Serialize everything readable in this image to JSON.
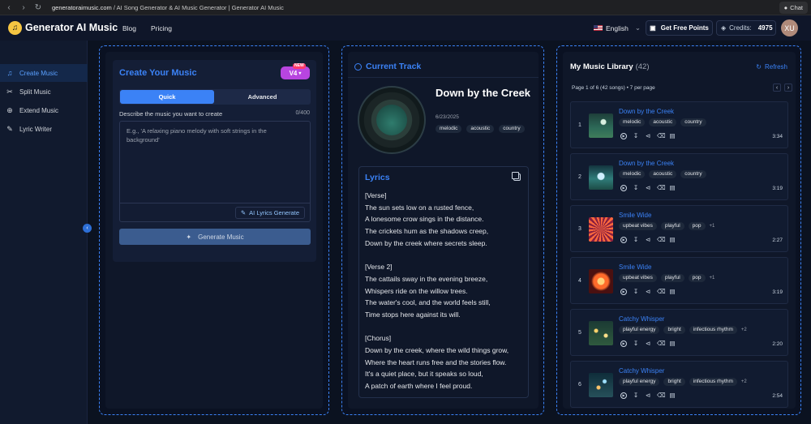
{
  "browser": {
    "url_host": "generatoraimusic.com",
    "url_rest": " / AI Song Generator & AI Music Generator | Generator AI Music",
    "chat_label": "Chat"
  },
  "header": {
    "logo_text": "Generator AI Music",
    "nav": [
      "Blog",
      "Pricing"
    ],
    "language": "English",
    "free_points_label": "Get Free Points",
    "credits_label": "Credits:",
    "credits_value": "4975",
    "avatar_initials": "XU"
  },
  "sidebar": {
    "items": [
      {
        "label": "Create Music",
        "icon": "music-note-icon",
        "active": true
      },
      {
        "label": "Split Music",
        "icon": "scissors-icon",
        "active": false
      },
      {
        "label": "Extend Music",
        "icon": "plus-circle-icon",
        "active": false
      },
      {
        "label": "Lyric Writer",
        "icon": "pencil-icon",
        "active": false
      }
    ]
  },
  "create": {
    "title": "Create Your Music",
    "version": "V4",
    "new_badge": "NEW",
    "tabs": {
      "quick": "Quick",
      "advanced": "Advanced"
    },
    "desc_label": "Describe the music you want to create",
    "char_count": "0/400",
    "placeholder": "E.g., 'A relaxing piano melody with soft strings in the background'",
    "ai_lyrics_label": "AI Lyrics Generate",
    "generate_label": "Generate Music"
  },
  "current": {
    "title": "Current Track",
    "song_title": "Down by the Creek",
    "date": "6/23/2025",
    "tags": [
      "melodic",
      "acoustic",
      "country"
    ],
    "lyrics_title": "Lyrics",
    "lyrics": [
      "[Verse]",
      "The sun sets low on a rusted fence,",
      "A lonesome crow sings in the distance.",
      "The crickets hum as the shadows creep,",
      "Down by the creek where secrets sleep.",
      "",
      "[Verse 2]",
      "The cattails sway in the evening breeze,",
      "Whispers ride on the willow trees.",
      "The water's cool, and the world feels still,",
      "Time stops here against its will.",
      "",
      "[Chorus]",
      "Down by the creek, where the wild things grow,",
      "Where the heart runs free and the stories flow.",
      "It's a quiet place, but it speaks so loud,",
      "A patch of earth where I feel proud."
    ]
  },
  "library": {
    "title": "My Music Library",
    "count": "(42)",
    "refresh_label": "Refresh",
    "page_info": "Page 1 of 6 (42 songs) • 7 per page",
    "songs": [
      {
        "idx": "1",
        "title": "Down by the Creek",
        "tags": [
          "melodic",
          "acoustic",
          "country"
        ],
        "more": "",
        "duration": "3:34",
        "thumb": "creek-1"
      },
      {
        "idx": "2",
        "title": "Down by the Creek",
        "tags": [
          "melodic",
          "acoustic",
          "country"
        ],
        "more": "",
        "duration": "3:19",
        "thumb": "creek-2"
      },
      {
        "idx": "3",
        "title": "Smile Wide",
        "tags": [
          "upbeat vibes",
          "playful",
          "pop"
        ],
        "more": "+1",
        "duration": "2:27",
        "thumb": "smile-1"
      },
      {
        "idx": "4",
        "title": "Smile Wide",
        "tags": [
          "upbeat vibes",
          "playful",
          "pop"
        ],
        "more": "+1",
        "duration": "3:19",
        "thumb": "smile-2"
      },
      {
        "idx": "5",
        "title": "Catchy Whisper",
        "tags": [
          "playful energy",
          "bright",
          "infectious rhythm"
        ],
        "more": "+2",
        "duration": "2:20",
        "thumb": "whisper-1"
      },
      {
        "idx": "6",
        "title": "Catchy Whisper",
        "tags": [
          "playful energy",
          "bright",
          "infectious rhythm"
        ],
        "more": "+2",
        "duration": "2:54",
        "thumb": "whisper-2"
      }
    ]
  },
  "colors": {
    "accent": "#3b82f6",
    "background": "#0b1220",
    "v4_badge": "#b845e0"
  }
}
